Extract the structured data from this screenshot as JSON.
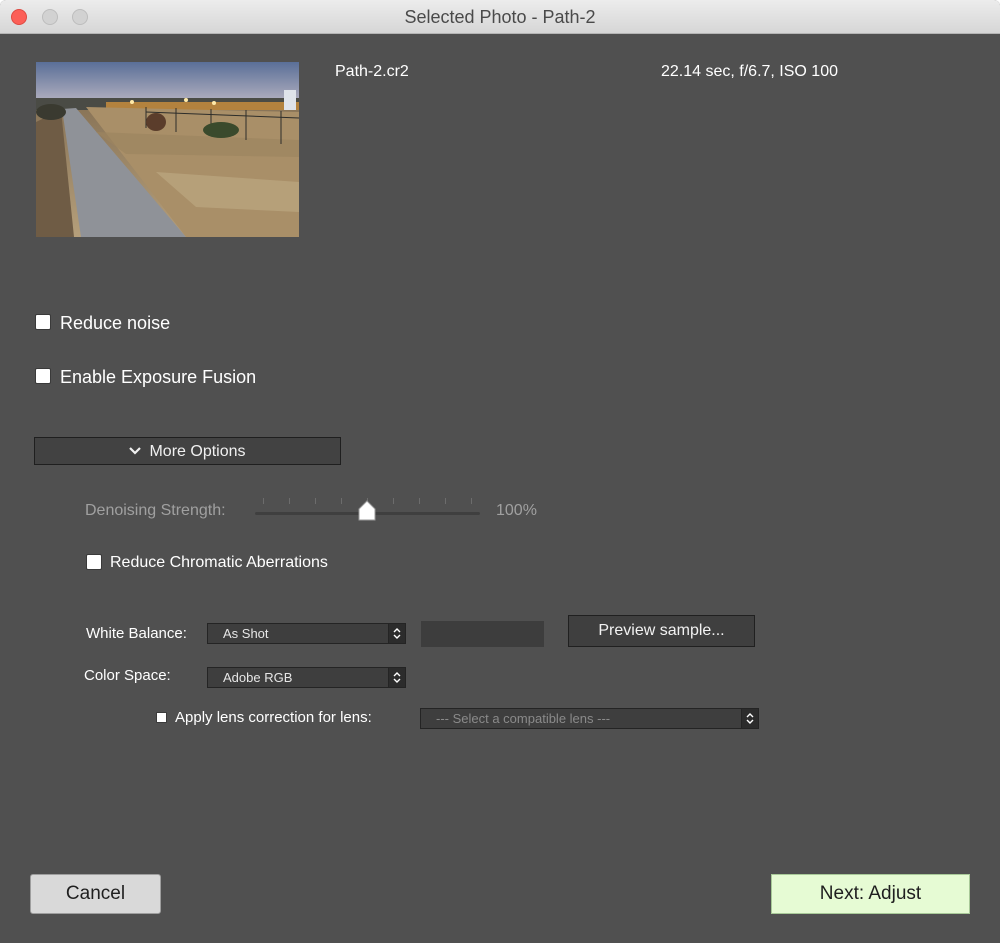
{
  "window": {
    "title": "Selected Photo - Path-2"
  },
  "photo": {
    "filename": "Path-2.cr2",
    "exposure": "22.14 sec, f/6.7, ISO 100"
  },
  "options": {
    "reduce_noise": {
      "label": "Reduce noise",
      "checked": false
    },
    "exposure_fusion": {
      "label": "Enable Exposure Fusion",
      "checked": false
    },
    "more_options_label": "More Options"
  },
  "advanced": {
    "denoising_label": "Denoising Strength:",
    "denoising_value": "100%",
    "denoising_level": 0.5,
    "chromatic": {
      "label": "Reduce Chromatic Aberrations",
      "checked": false
    },
    "white_balance": {
      "label": "White Balance:",
      "value": "As Shot"
    },
    "preview_button": "Preview sample...",
    "color_space": {
      "label": "Color Space:",
      "value": "Adobe RGB"
    },
    "lens": {
      "label": "Apply lens correction for lens:",
      "value": "--- Select a compatible lens ---",
      "checked": false
    }
  },
  "footer": {
    "cancel": "Cancel",
    "next": "Next: Adjust"
  },
  "colors": {
    "window_bg": "#505050",
    "next_button_bg": "#e6fbd4",
    "close_button": "#fc5f57"
  }
}
